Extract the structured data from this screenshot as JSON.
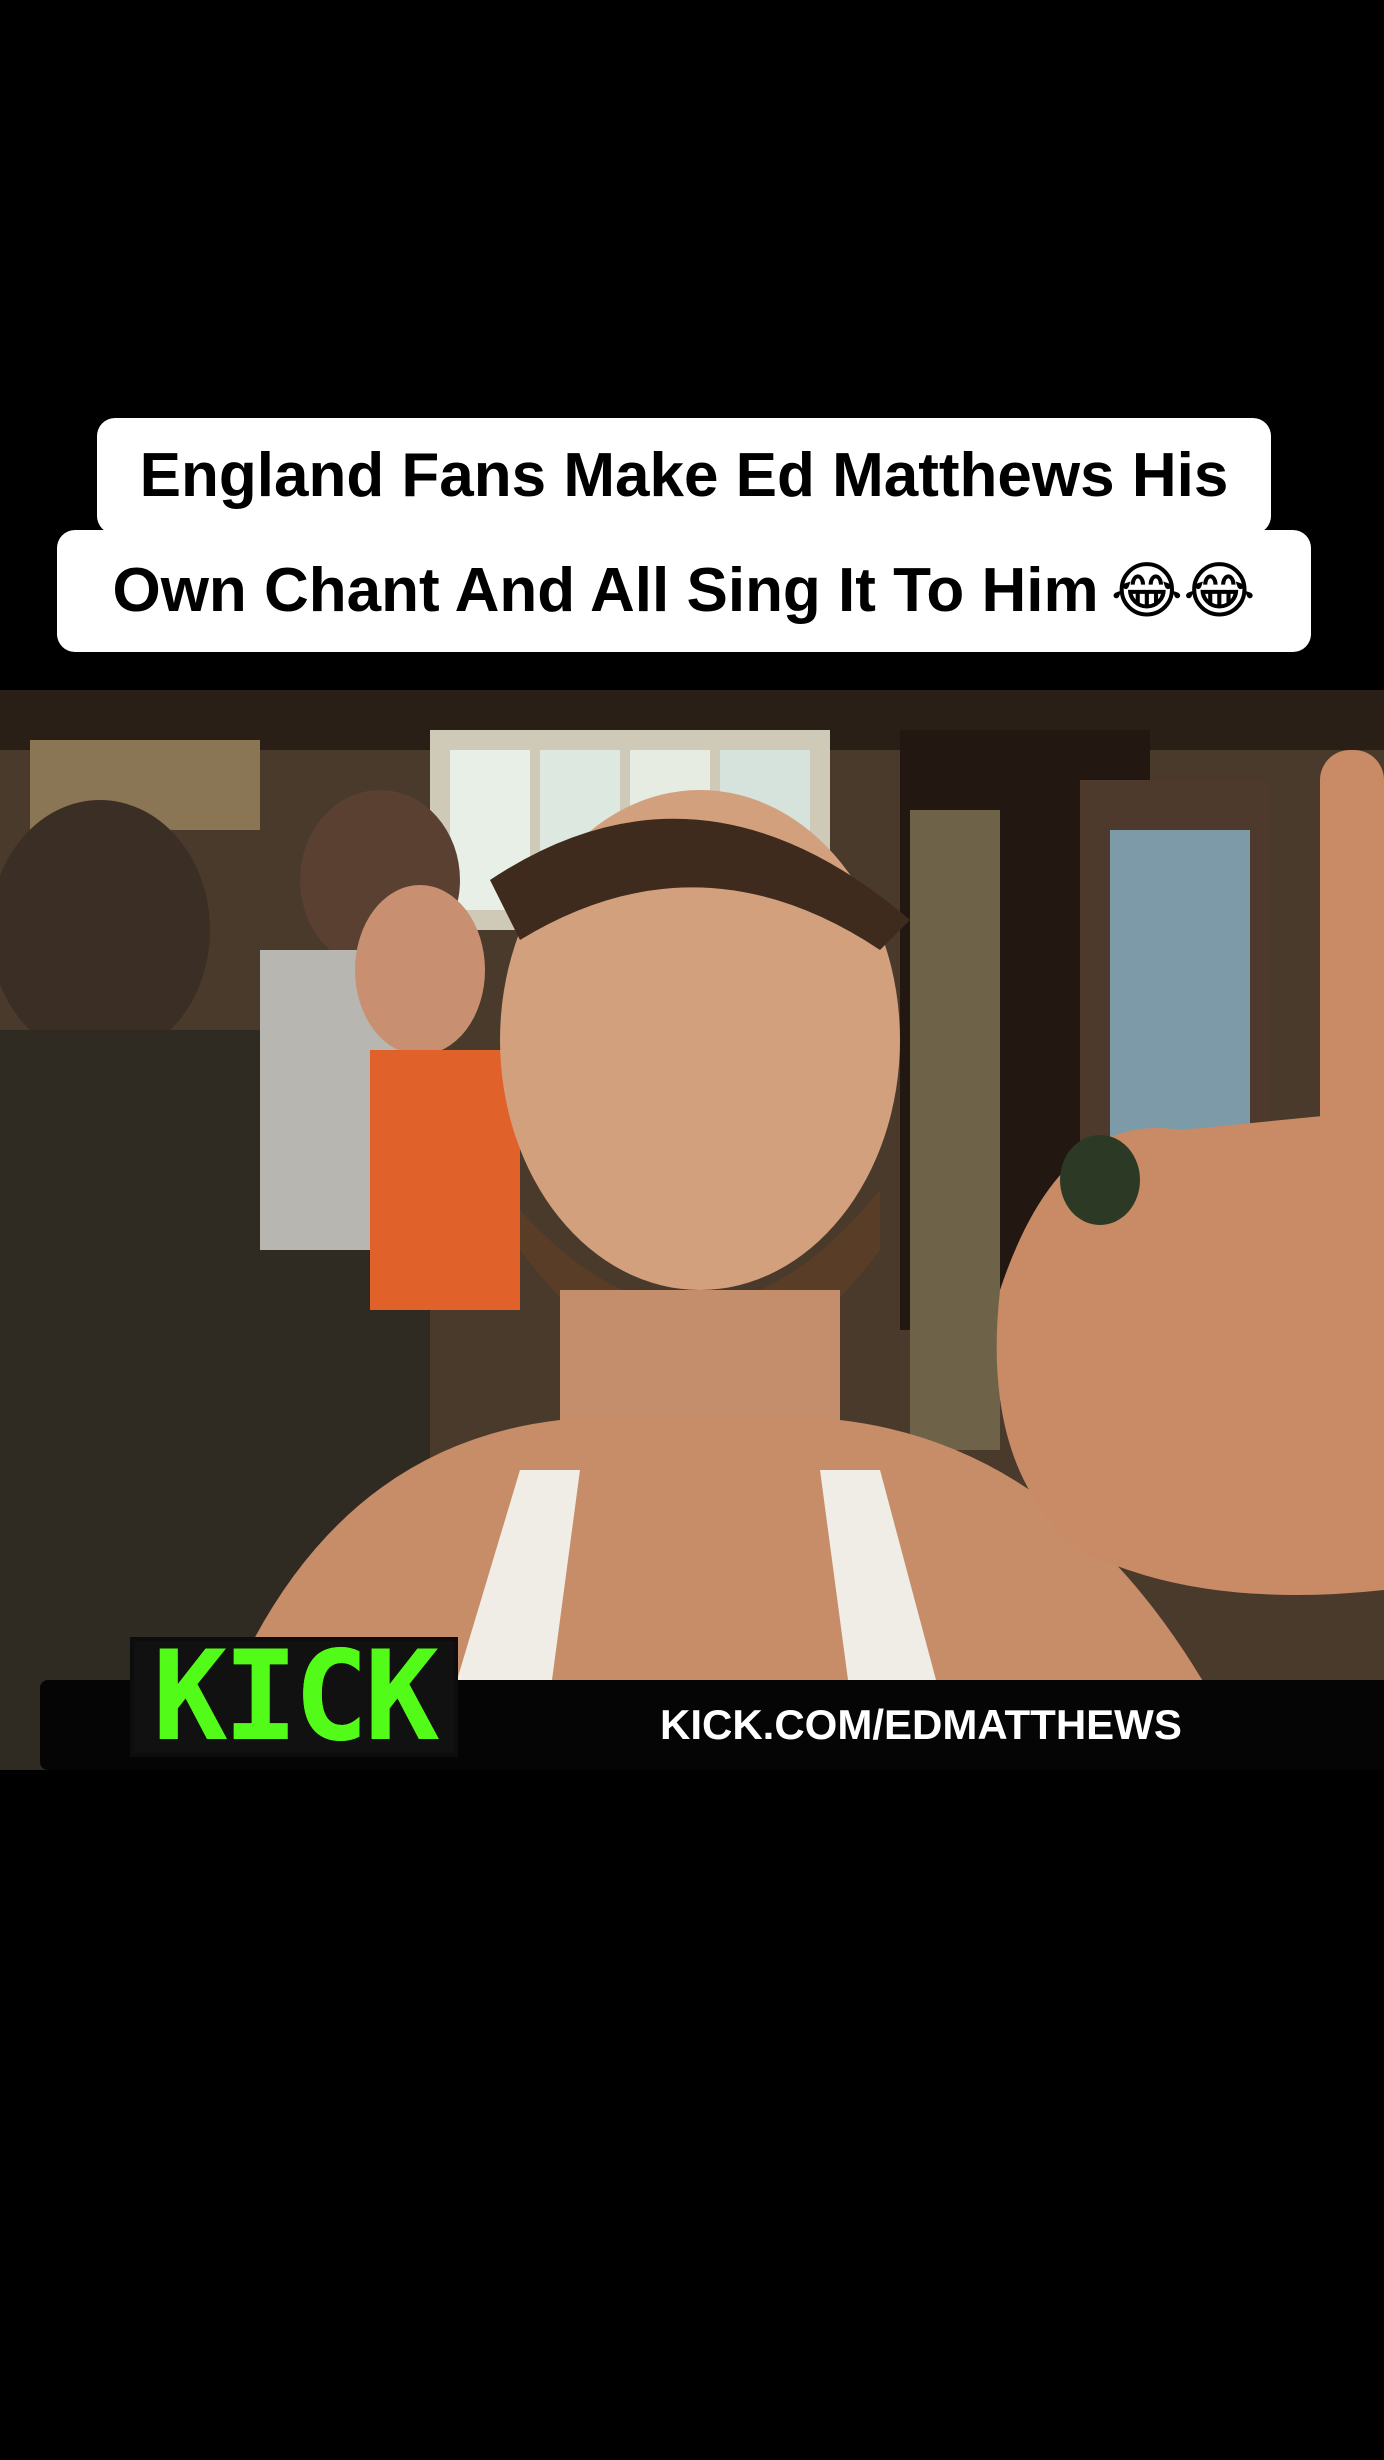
{
  "caption": {
    "line1": "England Fans Make Ed Matthews His",
    "line2": "Own Chant And All Sing It To Him",
    "emoji": "😂😂"
  },
  "overlay": {
    "logo_text": "KICK",
    "url_text": "KICK.COM/EDMATTHEWS",
    "logo_color": "#53fc18"
  },
  "colors": {
    "background": "#000000",
    "caption_bg": "#ffffff",
    "caption_text": "#000000"
  }
}
